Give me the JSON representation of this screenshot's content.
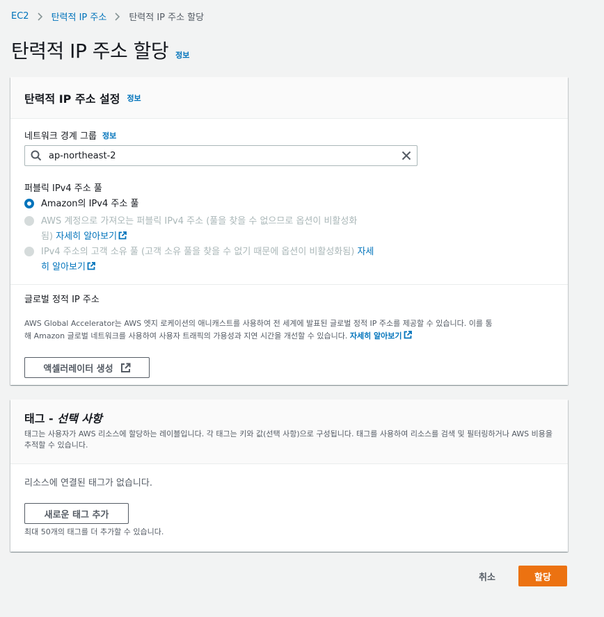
{
  "breadcrumb": {
    "items": [
      "EC2",
      "탄력적 IP 주소",
      "탄력적 IP 주소 할당"
    ]
  },
  "page": {
    "title": "탄력적 IP 주소 할당",
    "info": "정보"
  },
  "settings": {
    "title": "탄력적 IP 주소 설정",
    "info": "정보",
    "network_group_label": "네트워크 경계 그룹",
    "network_group_info": "정보",
    "network_group_value": "ap-northeast-2",
    "pool_label": "퍼블릭 IPv4 주소 풀",
    "options": [
      {
        "label": "Amazon의 IPv4 주소 풀",
        "selected": true,
        "disabled": false
      },
      {
        "label": "AWS 계정으로 가져오는 퍼블릭 IPv4 주소 (풀을 찾을 수 없으므로 옵션이 비활성화",
        "label_line2": "됨)",
        "link": "자세히 알아보기",
        "selected": false,
        "disabled": true
      },
      {
        "label": "IPv4 주소의 고객 소유 풀 (고객 소유 풀을 찾을 수 없기 때문에 옵션이 비활성화됨)",
        "link_part1": "자세",
        "link_part2": "히 알아보기",
        "selected": false,
        "disabled": true
      }
    ],
    "global_label": "글로벌 정적 IP 주소",
    "global_desc_line1": "AWS Global Accelerator는 AWS 엣지 로케이션의 애니캐스트를 사용하여 전 세계에 발표된 글로벌 정적 IP 주소를 제공할 수 있습니다. 이를 통",
    "global_desc_line2": "해 Amazon 글로벌 네트워크를 사용하여 사용자 트래픽의 가용성과 지연 시간을 개선할 수 있습니다.",
    "global_desc_link": "자세히 알아보기",
    "accelerator_button": "액셀러레이터 생성"
  },
  "tags": {
    "title_main": "태그 - ",
    "title_italic": "선택 사항",
    "desc": "태그는 사용자가 AWS 리소스에 할당하는 레이블입니다. 각 태그는 키와 값(선택 사항)으로 구성됩니다. 태그를 사용하여 리소스를 검색 및 필터링하거나 AWS 비용을 추적할 수 있습니다.",
    "empty_text": "리소스에 연결된 태그가 없습니다.",
    "add_button": "새로운 태그 추가",
    "limit_text": "최대 50개의 태그를 더 추가할 수 있습니다."
  },
  "footer": {
    "cancel": "취소",
    "submit": "할당"
  },
  "colors": {
    "link": "#0073bb",
    "primary": "#ec7211",
    "background": "#f2f3f3"
  }
}
